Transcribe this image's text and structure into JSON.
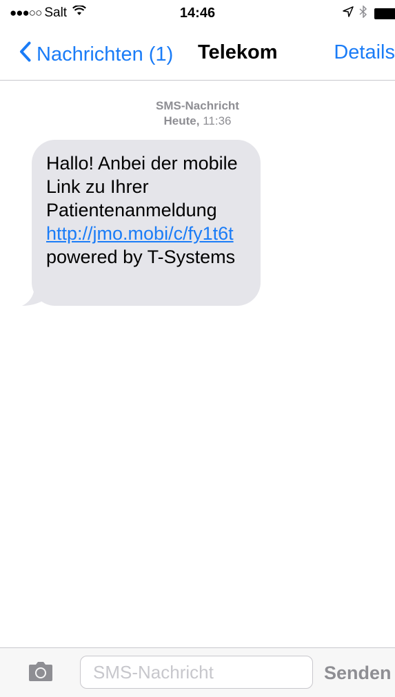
{
  "status_bar": {
    "signal_dots": "●●●○○",
    "carrier": "Salt",
    "time": "14:46"
  },
  "nav": {
    "back_label": "Nachrichten (1)",
    "title": "Telekom",
    "details_label": "Details"
  },
  "message_header": {
    "type": "SMS-Nachricht",
    "day": "Heute,",
    "time": "11:36"
  },
  "message": {
    "text_before_link": "Hallo! Anbei der mobile Link zu Ihrer Patientenanmeldung",
    "link": "http://jmo.mobi/c/fy1t6t",
    "text_after_link": " powered by T-Systems"
  },
  "input_bar": {
    "placeholder": "SMS-Nachricht",
    "send_label": "Senden"
  },
  "icons": {
    "back": "chevron-left-icon",
    "wifi": "wifi-icon",
    "location": "location-arrow-icon",
    "bluetooth": "bluetooth-icon",
    "battery": "battery-icon",
    "camera": "camera-icon"
  },
  "colors": {
    "accent": "#1a7cf7",
    "bubble": "#e5e5ea",
    "secondary_text": "#8e8e93"
  }
}
